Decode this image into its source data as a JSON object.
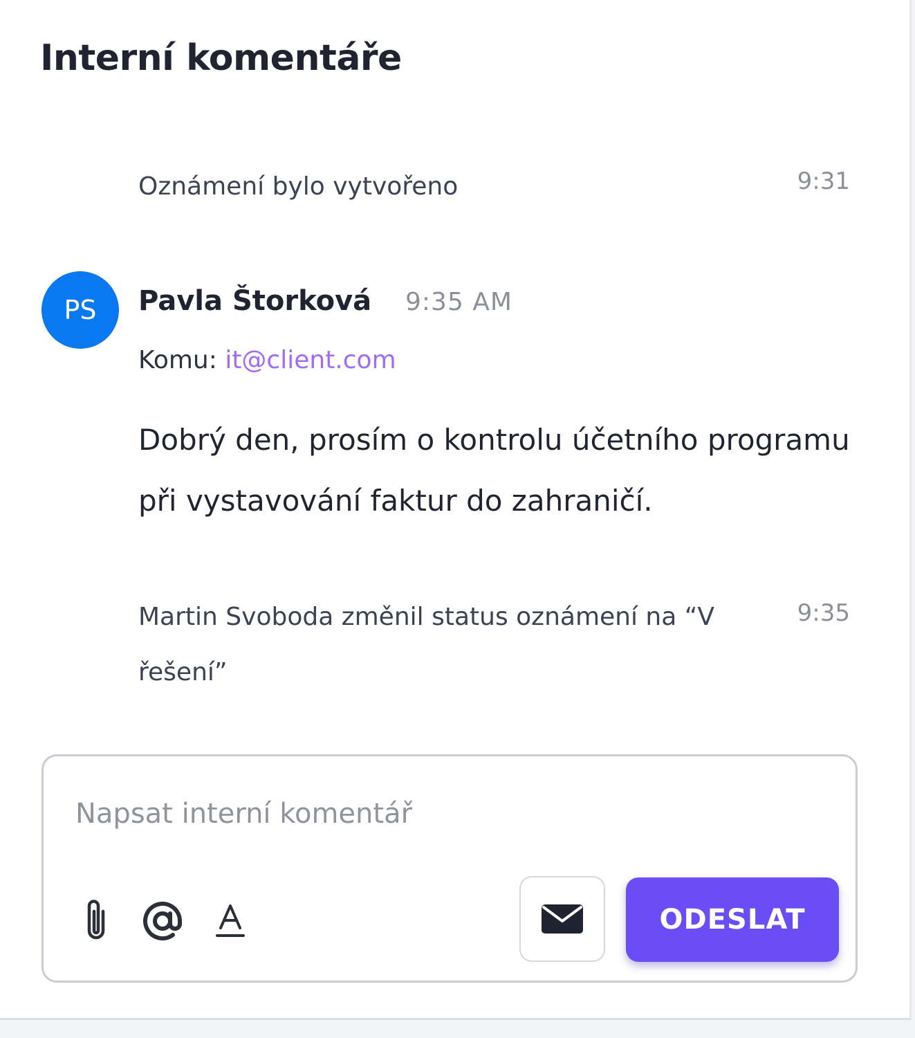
{
  "panel": {
    "title": "Interní komentáře"
  },
  "timeline": {
    "created_event": {
      "text": "Oznámení bylo vytvořeno",
      "time": "9:31"
    },
    "message": {
      "avatar_initials": "PS",
      "avatar_color": "#0a78ee",
      "author": "Pavla Štorková",
      "time": "9:35 AM",
      "recipient_label": "Komu:",
      "recipient_email": "it@client.com",
      "body": "Dobrý den, prosím o kontrolu účetního programu při vystavování faktur do zahraničí."
    },
    "status_event": {
      "text": "Martin Svoboda změnil status oznámení na “V řešení”",
      "time": "9:35"
    }
  },
  "composer": {
    "placeholder": "Napsat interní komentář",
    "value": "",
    "tools": [
      "paperclip-icon",
      "at-sign-icon",
      "text-format-icon"
    ],
    "mail_icon": "envelope-icon",
    "send_label": "ODESLAT",
    "accent_color": "#6a4df5"
  }
}
